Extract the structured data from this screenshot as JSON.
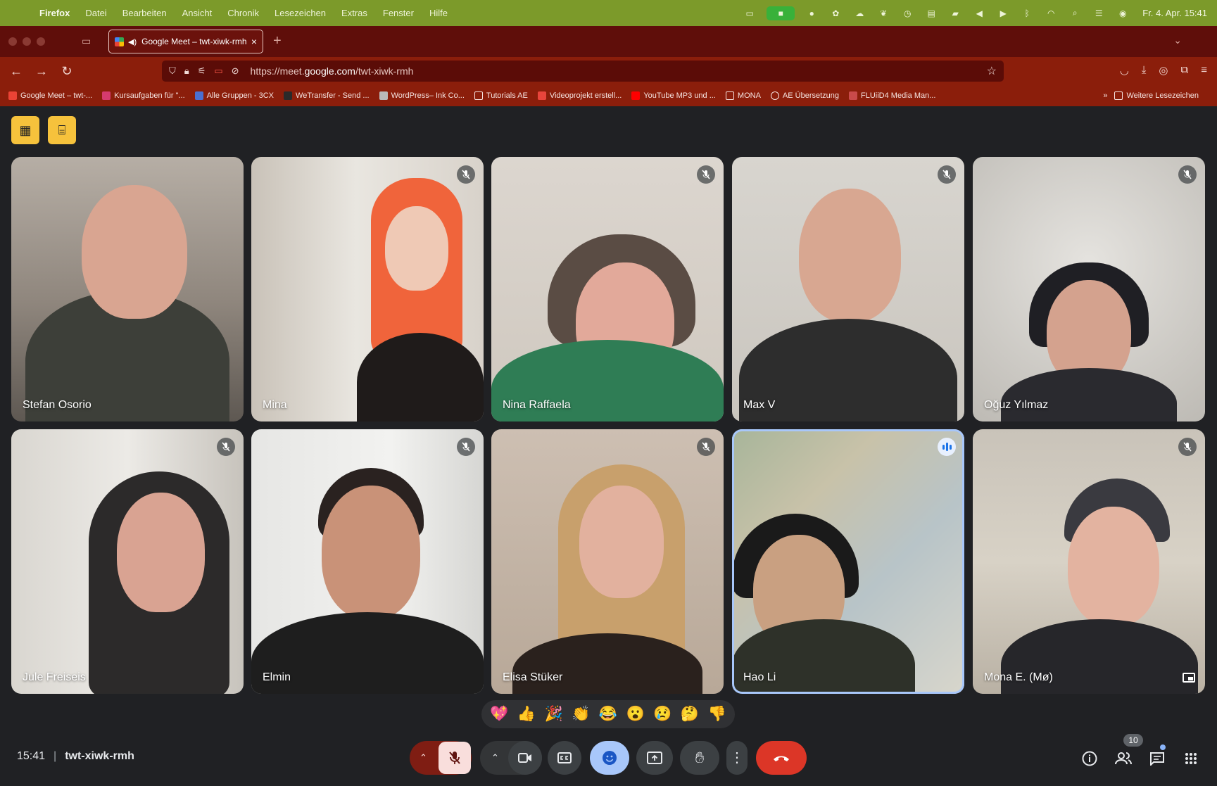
{
  "menubar": {
    "app": "Firefox",
    "items": [
      "Datei",
      "Bearbeiten",
      "Ansicht",
      "Chronik",
      "Lesezeichen",
      "Extras",
      "Fenster",
      "Hilfe"
    ],
    "clock": "Fr. 4. Apr.  15:41"
  },
  "browser": {
    "tab_title": "Google Meet – twt-xiwk-rmh",
    "url_prefix": "https://meet.",
    "url_domain": "google.com",
    "url_path": "/twt-xiwk-rmh",
    "bookmarks": [
      {
        "label": "Google Meet – twt-...",
        "color": "#ea4335"
      },
      {
        "label": "Kursaufgaben für \"...",
        "color": "#d63b6e"
      },
      {
        "label": "Alle Gruppen - 3CX",
        "color": "#4a6fd1"
      },
      {
        "label": "WeTransfer - Send ...",
        "color": "#2a2a2a"
      },
      {
        "label": "WordPress– Ink Co...",
        "color": "#b9b9b9"
      },
      {
        "label": "Tutorials AE",
        "color": "folder"
      },
      {
        "label": "Videoprojekt erstell...",
        "color": "#e8453c"
      },
      {
        "label": "YouTube MP3 und ...",
        "color": "#ff0000"
      },
      {
        "label": "MONA",
        "color": "folder"
      },
      {
        "label": "AE Übersetzung",
        "color": "globe"
      },
      {
        "label": "FLUiiD4 Media Man...",
        "color": "#c94a4a"
      }
    ],
    "more_bookmarks": "Weitere Lesezeichen"
  },
  "participants": [
    {
      "name": "Stefan Osorio",
      "muted": false,
      "speaking": false
    },
    {
      "name": "Mina",
      "muted": true,
      "speaking": false
    },
    {
      "name": "Nina Raffaela",
      "muted": true,
      "speaking": false
    },
    {
      "name": "Max V",
      "muted": true,
      "speaking": false
    },
    {
      "name": "Oğuz Yılmaz",
      "muted": true,
      "speaking": false
    },
    {
      "name": "Jule Freiseis",
      "muted": true,
      "speaking": false
    },
    {
      "name": "Elmin",
      "muted": true,
      "speaking": false
    },
    {
      "name": "Elisa Stüker",
      "muted": true,
      "speaking": false
    },
    {
      "name": "Hao Li",
      "muted": false,
      "speaking": true
    },
    {
      "name": "Mona E. (Mø)",
      "muted": true,
      "speaking": false
    }
  ],
  "reactions": [
    "💖",
    "👍",
    "🎉",
    "👏",
    "😂",
    "😮",
    "😢",
    "🤔",
    "👎"
  ],
  "meeting": {
    "time": "15:41",
    "code": "twt-xiwk-rmh",
    "participant_count": "10"
  }
}
